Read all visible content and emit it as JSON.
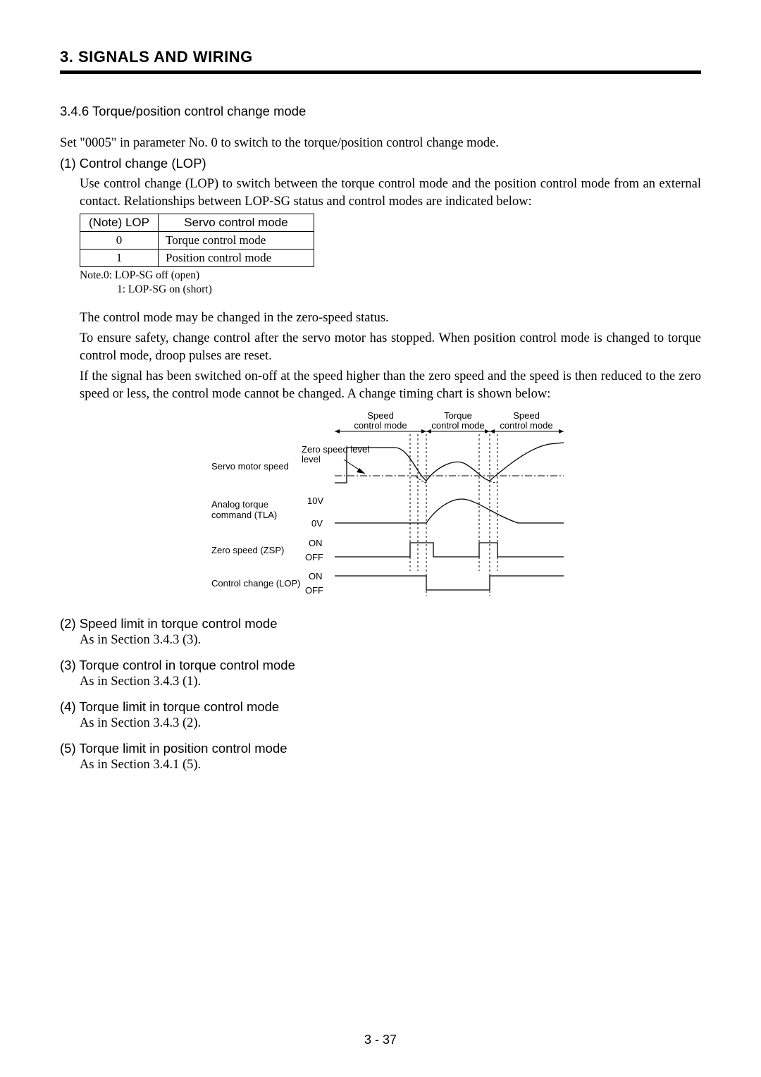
{
  "chapter_title": "3. SIGNALS AND WIRING",
  "section_heading": "3.4.6 Torque/position control change mode",
  "intro_line": "Set \"0005\" in parameter No. 0 to switch to the torque/position control change mode.",
  "item1": {
    "heading": "(1) Control change (LOP)",
    "para": "Use control change (LOP) to switch between the torque control mode and the position control mode from an external contact. Relationships between LOP-SG status and control modes are indicated below:"
  },
  "lop_table": {
    "headers": [
      "(Note) LOP",
      "Servo control mode"
    ],
    "rows": [
      [
        "0",
        "Torque control mode"
      ],
      [
        "1",
        "Position control mode"
      ]
    ]
  },
  "table_note": {
    "line1": "Note.0: LOP-SG off (open)",
    "line2": "1: LOP-SG on (short)"
  },
  "para_block": {
    "p1": "The control mode may be changed in the zero-speed status.",
    "p2": "To ensure safety, change control after the servo motor has stopped. When position control mode is changed to torque control mode, droop pulses are reset.",
    "p3": "If the signal has been switched on-off at the speed higher than the zero speed and the speed is then reduced to the zero speed or less, the control mode cannot be changed. A change timing chart is shown below:"
  },
  "chart_data": {
    "type": "timing-diagram",
    "mode_bands": [
      {
        "label_top": "Speed",
        "label_bot": "control mode"
      },
      {
        "label_top": "Torque",
        "label_bot": "control mode"
      },
      {
        "label_top": "Speed",
        "label_bot": "control mode"
      }
    ],
    "row_labels": [
      "Servo motor speed",
      "Analog torque command (TLA)",
      "Zero speed (ZSP)",
      "Control change (LOP)"
    ],
    "annotations": {
      "zero_speed_level": "Zero speed level",
      "tla_high": "10V",
      "tla_low": "0V",
      "digital_high": "ON",
      "digital_low": "OFF"
    }
  },
  "subitems": [
    {
      "head": "(2) Speed limit in torque control mode",
      "body": "As in Section 3.4.3 (3)."
    },
    {
      "head": "(3) Torque control in torque control mode",
      "body": "As in Section 3.4.3 (1)."
    },
    {
      "head": "(4) Torque limit in torque control mode",
      "body": "As in Section 3.4.3 (2)."
    },
    {
      "head": "(5) Torque limit in position control mode",
      "body": "As in Section 3.4.1 (5)."
    }
  ],
  "page_number": "3 -  37"
}
